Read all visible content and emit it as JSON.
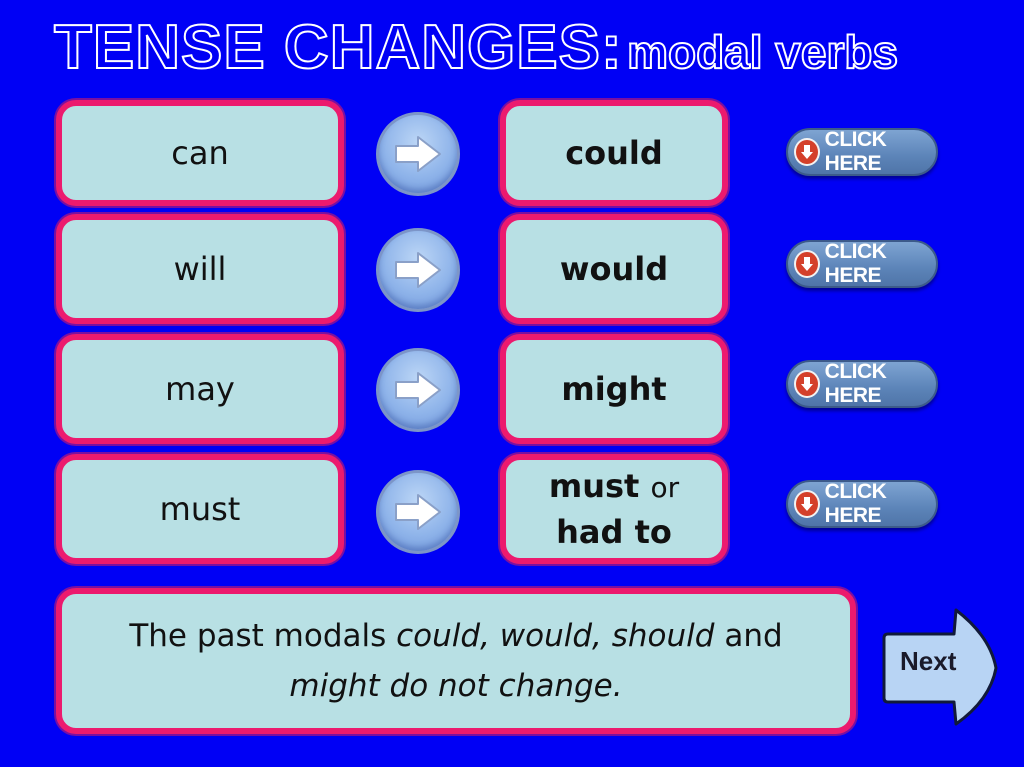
{
  "title": {
    "main": "TENSE CHANGES:",
    "sub": "modal verbs"
  },
  "rows": [
    {
      "present": "can",
      "past": "could",
      "button": "CLICK HERE"
    },
    {
      "present": "will",
      "past": "would",
      "button": "CLICK HERE"
    },
    {
      "present": "may",
      "past": "might",
      "button": "CLICK HERE"
    },
    {
      "present": "must",
      "past_bold": "must",
      "past_or": "or",
      "past_line2": "had to",
      "button": "CLICK HERE"
    }
  ],
  "note": {
    "t1": "The past modals ",
    "i1": "could, would, should",
    "t2": " and",
    "i2": "might do not change."
  },
  "next_label": "Next",
  "colors": {
    "background": "#0000f5",
    "box_fill": "#b8e0e4",
    "box_border": "#ec1a6e"
  }
}
